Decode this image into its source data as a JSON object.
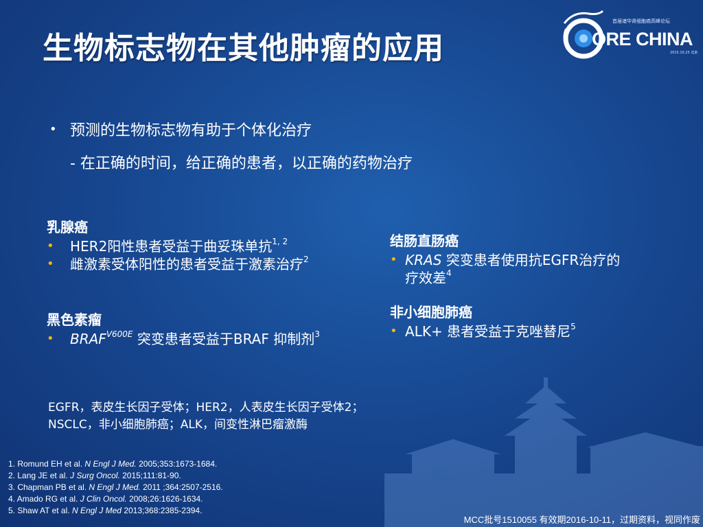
{
  "title": "生物标志物在其他肿瘤的应用",
  "logo": {
    "mark_letter": "C",
    "text": "ORE CHINA",
    "subtitle": "首届诸华肾细胞癌高峰论坛",
    "date": "2015.10.25 北京"
  },
  "intro": {
    "bullet": "预测的生物标志物有助于个体化治疗",
    "sub": "- 在正确的时间，给正确的患者，以正确的药物治疗"
  },
  "breast": {
    "heading": "乳腺癌",
    "item1": "HER2阳性患者受益于曲妥珠单抗",
    "item1_ref": "1, 2",
    "item2": "雌激素受体阳性的患者受益于激素治疗",
    "item2_ref": "2"
  },
  "melanoma": {
    "heading": "黑色素瘤",
    "gene": "BRAF",
    "mutation": "V600E",
    "text": " 突变患者受益于BRAF 抑制剂",
    "ref": "3"
  },
  "colorectal": {
    "heading": "结肠直肠癌",
    "gene": "KRAS",
    "text": " 突变患者使用抗EGFR治疗的疗效差",
    "ref": "4"
  },
  "nsclc": {
    "heading": "非小细胞肺癌",
    "text": "ALK+ 患者受益于克唑替尼",
    "ref": "5"
  },
  "abbreviations": [
    "EGFR，表皮生长因子受体；HER2，人表皮生长因子受体2；",
    "NSCLC，非小细胞肺癌；ALK，间变性淋巴瘤激酶"
  ],
  "references": [
    {
      "pre": "1. Romund EH et al. ",
      "journal": "N Engl J Med.",
      "post": " 2005;353:1673-1684."
    },
    {
      "pre": "2. Lang JE et al. ",
      "journal": "J Surg Oncol.",
      "post": " 2015;111:81-90."
    },
    {
      "pre": "3. Chapman PB et al. ",
      "journal": "N Engl J Med.",
      "post": " 2011 ;364:2507-2516."
    },
    {
      "pre": "4. Amado RG et al. ",
      "journal": "J Clin Oncol.",
      "post": " 2008;26:1626-1634."
    },
    {
      "pre": "5. Shaw AT et al. ",
      "journal": "N Engl J Med",
      "post": " 2013;368:2385-2394."
    }
  ],
  "footer": "MCC批号1510055 有效期2016-10-11，过期资料，视同作废",
  "colors": {
    "background": "#17468f",
    "bullet_accent": "#f2b21b",
    "text": "#ffffff"
  }
}
